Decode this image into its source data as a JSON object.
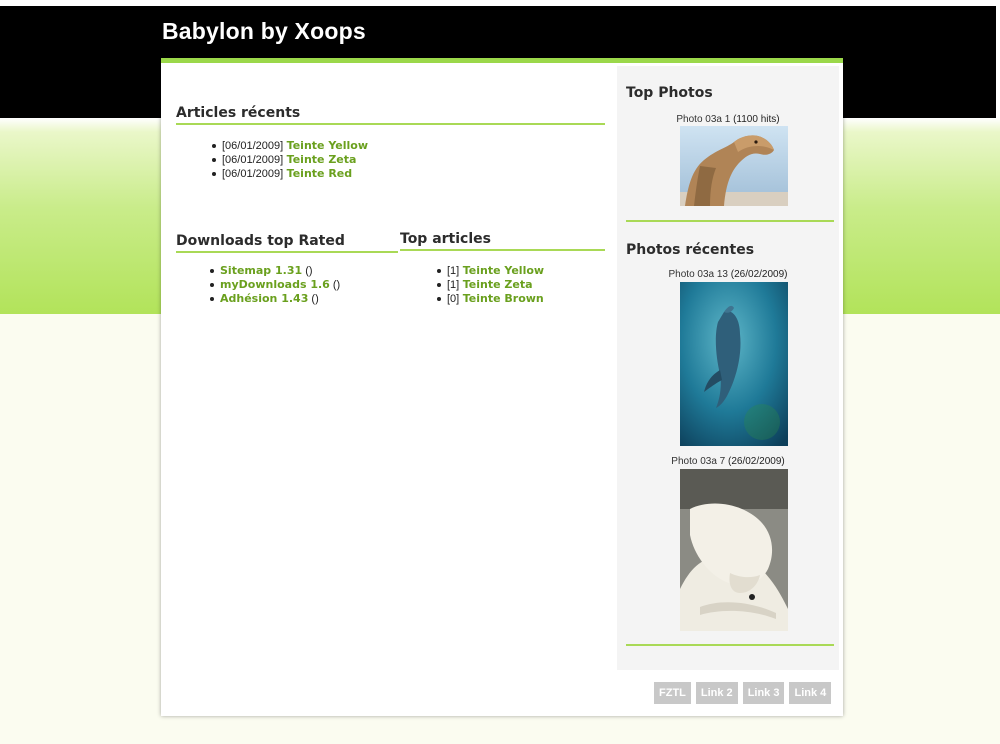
{
  "site": {
    "title": "Babylon by Xoops"
  },
  "colors": {
    "accent_green": "#a9d956",
    "link_green": "#6aa01e",
    "header_black": "#000000"
  },
  "recent_articles": {
    "heading": "Articles récents",
    "items": [
      {
        "date": "[06/01/2009]",
        "title": "Teinte Yellow"
      },
      {
        "date": "[06/01/2009]",
        "title": "Teinte Zeta"
      },
      {
        "date": "[06/01/2009]",
        "title": "Teinte Red"
      }
    ]
  },
  "downloads_top_rated": {
    "heading": "Downloads top Rated",
    "items": [
      {
        "title": "Sitemap 1.31",
        "suffix": " ()"
      },
      {
        "title": "myDownloads 1.6",
        "suffix": " ()"
      },
      {
        "title": "Adhésion 1.43",
        "suffix": " ()"
      }
    ]
  },
  "top_articles": {
    "heading": "Top articles",
    "items": [
      {
        "count": "[1]",
        "title": "Teinte Yellow"
      },
      {
        "count": "[1]",
        "title": "Teinte Zeta"
      },
      {
        "count": "[0]",
        "title": "Teinte Brown"
      }
    ]
  },
  "sidebar": {
    "top_photos": {
      "heading": "Top Photos",
      "photo": {
        "title": "Photo 03a 1",
        "meta": " (1100 hits)",
        "icon": "camel-photo"
      }
    },
    "recent_photos": {
      "heading": "Photos récentes",
      "photos": [
        {
          "title": "Photo 03a 13",
          "meta": " (26/02/2009)",
          "icon": "dolphin-photo"
        },
        {
          "title": "Photo 03a 7",
          "meta": " (26/02/2009)",
          "icon": "polar-bear-photo"
        }
      ]
    }
  },
  "footer": {
    "links": [
      "FZTL",
      "Link 2",
      "Link 3",
      "Link 4"
    ]
  }
}
